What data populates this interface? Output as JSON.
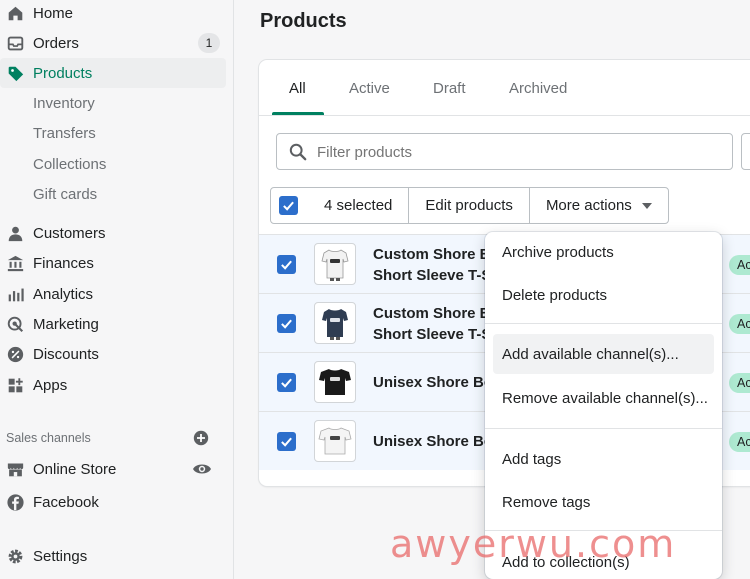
{
  "sidebar": {
    "items": [
      {
        "label": "Home",
        "icon": "home-icon"
      },
      {
        "label": "Orders",
        "icon": "inbox-icon",
        "badge": "1"
      },
      {
        "label": "Products",
        "icon": "tag-icon"
      },
      {
        "label": "Inventory"
      },
      {
        "label": "Transfers"
      },
      {
        "label": "Collections"
      },
      {
        "label": "Gift cards"
      },
      {
        "label": "Customers",
        "icon": "person-icon"
      },
      {
        "label": "Finances",
        "icon": "bank-icon"
      },
      {
        "label": "Analytics",
        "icon": "bar-chart-icon"
      },
      {
        "label": "Marketing",
        "icon": "target-icon"
      },
      {
        "label": "Discounts",
        "icon": "discount-icon"
      },
      {
        "label": "Apps",
        "icon": "apps-icon"
      }
    ],
    "sales_channels_title": "Sales channels",
    "channels": [
      {
        "label": "Online Store",
        "icon": "store-icon"
      },
      {
        "label": "Facebook",
        "icon": "facebook-icon"
      }
    ],
    "settings_label": "Settings"
  },
  "page": {
    "title": "Products",
    "tabs": [
      "All",
      "Active",
      "Draft",
      "Archived"
    ],
    "filter_placeholder": "Filter products",
    "bulk": {
      "selected_label": "4 selected",
      "edit_label": "Edit products",
      "more_label": "More actions"
    },
    "products": [
      {
        "name_line1": "Custom Shore B",
        "name_line2": "Short Sleeve T-S",
        "status": "Ac"
      },
      {
        "name_line1": "Custom Shore B",
        "name_line2": "Short Sleeve T-S",
        "status": "Ac"
      },
      {
        "name_line1": "Unisex Shore Bo",
        "status": "Ac"
      },
      {
        "name_line1": "Unisex Shore Bo",
        "status": "Ac"
      }
    ]
  },
  "dropdown": {
    "items": [
      "Archive products",
      "Delete products",
      "Add available channel(s)...",
      "Remove available channel(s)...",
      "Add tags",
      "Remove tags",
      "Add to collection(s)"
    ]
  },
  "watermark": "awyerwu.com",
  "colors": {
    "accent": "#008060",
    "checkbox": "#2c6ecb",
    "selected_row": "#f2f7fe",
    "status_active": "#aee9d1"
  }
}
